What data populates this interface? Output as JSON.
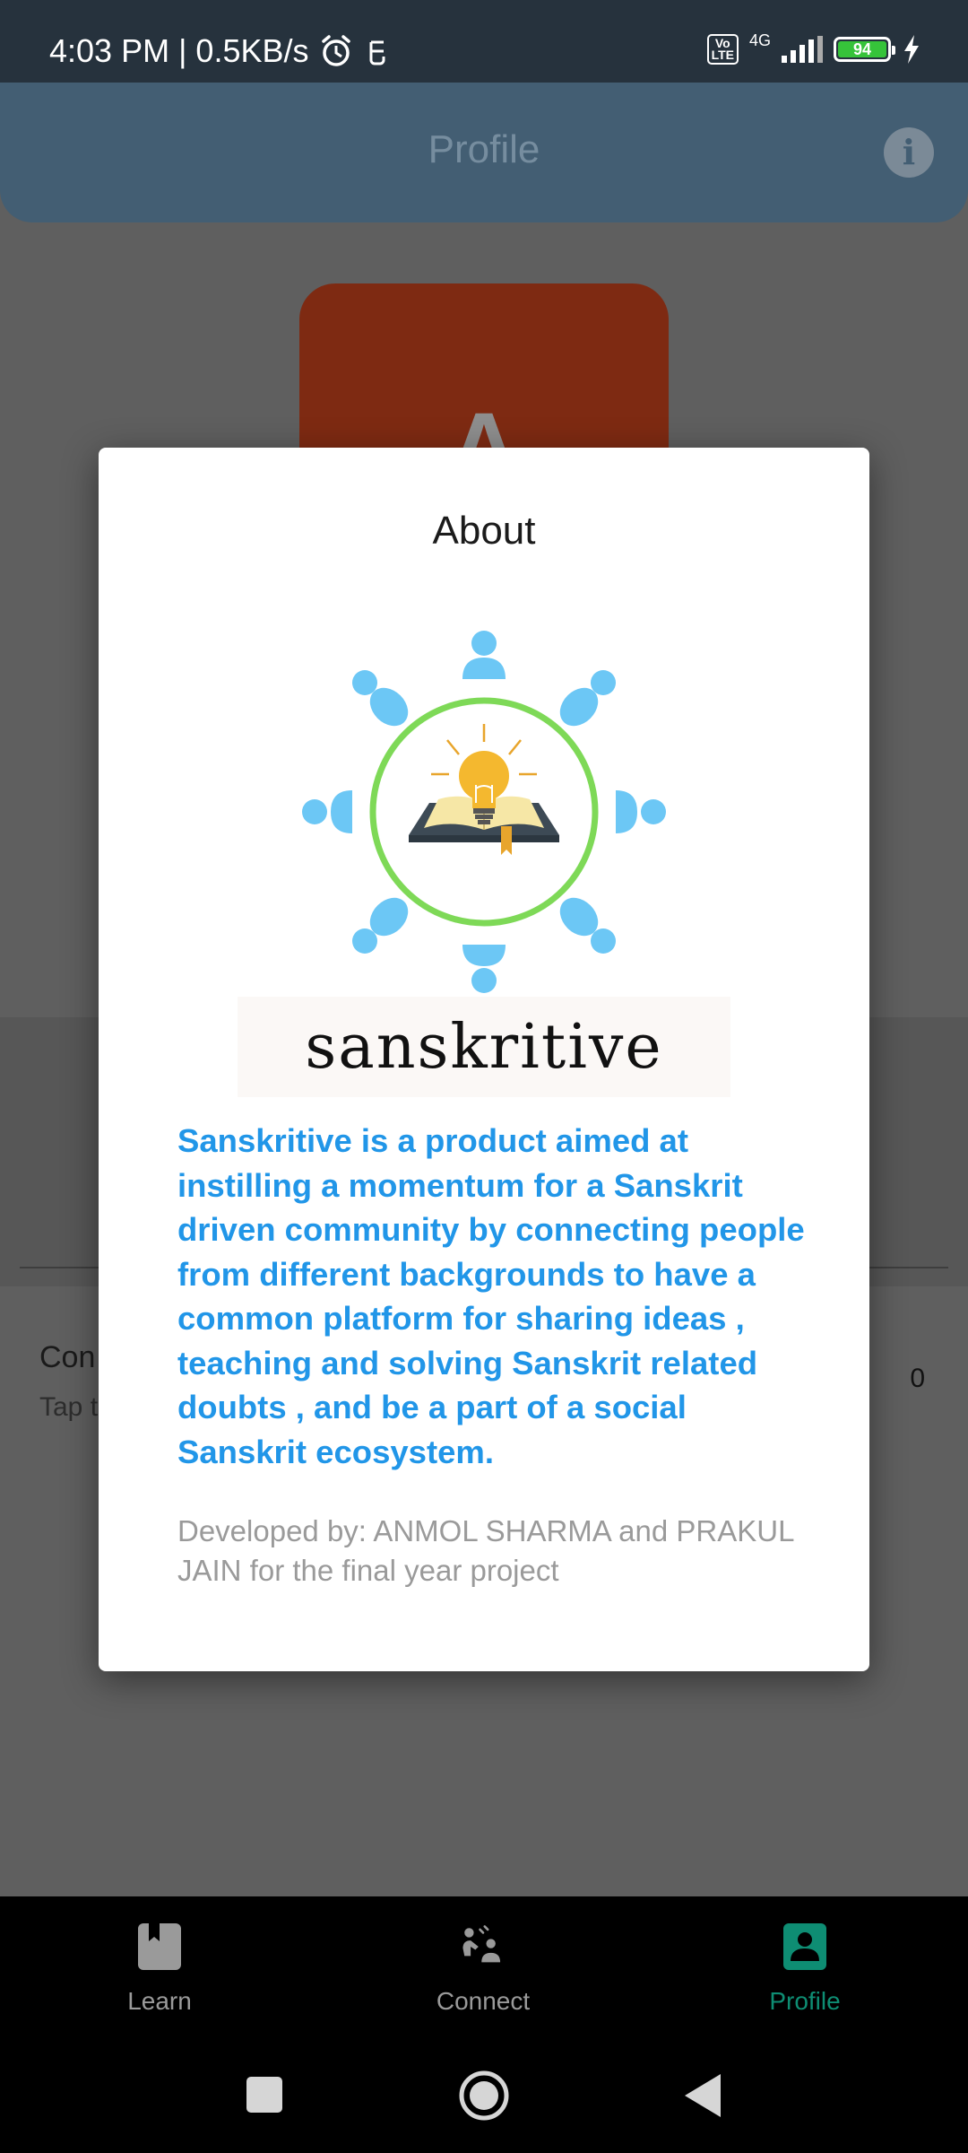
{
  "status_bar": {
    "time_speed": "4:03 PM | 0.5KB/s",
    "network": "4G",
    "volte": "Vo LTE",
    "battery": "94",
    "icons": [
      "alarm-icon",
      "app-notification-icon",
      "volte-icon",
      "signal-icon",
      "battery-icon",
      "charging-icon"
    ]
  },
  "app_bar": {
    "title": "Profile",
    "info_icon": "info-icon"
  },
  "background": {
    "avatar_letter": "A",
    "connections_title": "Con",
    "connections_subtitle": "Tap t",
    "connections_count": "0"
  },
  "modal": {
    "title": "About",
    "logo_word": "sanskritive",
    "description": "Sanskritive is a product aimed at instilling a momentum for a Sanskrit driven community by connecting people from different backgrounds to have a common platform for sharing ideas , teaching and solving Sanskrit related doubts , and be a part of a social Sanskrit ecosystem.",
    "developer": "Developed by: ANMOL SHARMA and PRAKUL JAIN for the final year project"
  },
  "bottom_nav": {
    "items": [
      {
        "label": "Learn",
        "icon": "book-icon",
        "active": false
      },
      {
        "label": "Connect",
        "icon": "connect-icon",
        "active": false
      },
      {
        "label": "Profile",
        "icon": "profile-icon",
        "active": true
      }
    ]
  },
  "system_nav": [
    "recents-button",
    "home-button",
    "back-button"
  ],
  "colors": {
    "accent": "#0e8d73",
    "about_text": "#2196e8",
    "app_bar": "#435e73",
    "avatar_bg": "#7e2a12"
  }
}
